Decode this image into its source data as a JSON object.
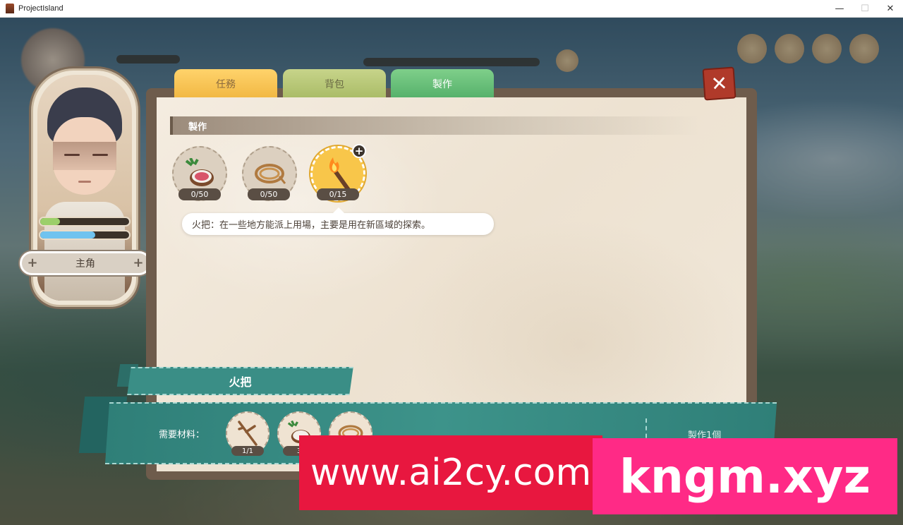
{
  "window": {
    "title": "ProjectIsland",
    "minimize": "—",
    "maximize": "☐",
    "close": "✕"
  },
  "character": {
    "name": "主角",
    "health_fraction": 0.22,
    "stamina_fraction": 0.62,
    "colors": {
      "health": "#9ccf6a",
      "stamina": "#6fc3ef"
    }
  },
  "tabs": [
    {
      "label": "任務"
    },
    {
      "label": "背包"
    },
    {
      "label": "製作"
    }
  ],
  "close_label": "✕",
  "section": {
    "title": "製作"
  },
  "recipes": [
    {
      "icon": "coconut-icon",
      "count": "0/50"
    },
    {
      "icon": "rope-icon",
      "count": "0/50"
    },
    {
      "icon": "torch-icon",
      "count": "0/15",
      "selected": true
    }
  ],
  "add_badge": "+",
  "tooltip": "火把：在一些地方能派上用場，主要是用在新區域的探索。",
  "craft_panel": {
    "item_name": "火把",
    "required_label": "需要材料：",
    "materials": [
      {
        "icon": "stick-icon",
        "count": "1/1"
      },
      {
        "icon": "coconut-icon",
        "count": "3"
      },
      {
        "icon": "rope-icon",
        "count": ""
      }
    ],
    "craft_button": "製作1個"
  },
  "watermarks": {
    "left": "www.ai2cy.com",
    "right": "kngm.xyz"
  }
}
